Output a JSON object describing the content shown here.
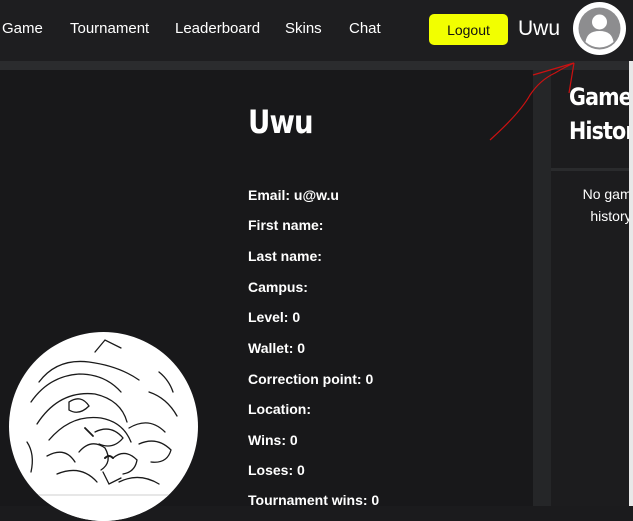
{
  "navbar": {
    "links": [
      "Game",
      "Tournament",
      "Leaderboard",
      "Skins",
      "Chat"
    ],
    "logout_label": "Logout",
    "username": "Uwu"
  },
  "profile": {
    "name": "Uwu",
    "fields": [
      {
        "label": "Email:",
        "value": "u@w.u"
      },
      {
        "label": "First name:",
        "value": ""
      },
      {
        "label": "Last name:",
        "value": ""
      },
      {
        "label": "Campus:",
        "value": ""
      },
      {
        "label": "Level:",
        "value": "0"
      },
      {
        "label": "Wallet:",
        "value": "0"
      },
      {
        "label": "Correction point:",
        "value": "0"
      },
      {
        "label": "Location:",
        "value": ""
      },
      {
        "label": "Wins:",
        "value": "0"
      },
      {
        "label": "Loses:",
        "value": "0"
      },
      {
        "label": "Tournament wins:",
        "value": "0"
      }
    ]
  },
  "history": {
    "title": "Game History",
    "empty_text": "No game history"
  },
  "icons": {
    "avatar": "user-circle-icon"
  },
  "colors": {
    "logout_bg": "#f2ff00",
    "annotation": "#cc1111"
  }
}
